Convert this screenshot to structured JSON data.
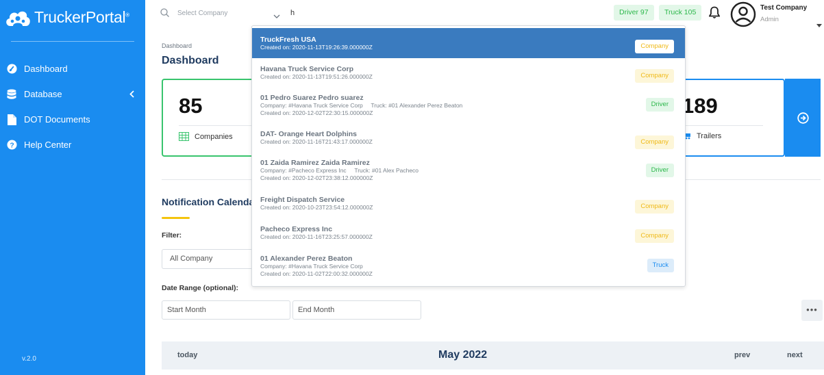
{
  "app": {
    "name": "TruckerPortal",
    "trademark": "®",
    "version": "v.2.0"
  },
  "sidebar": {
    "items": [
      {
        "label": "Dashboard",
        "icon": "dashboard-icon"
      },
      {
        "label": "Database",
        "icon": "database-icon"
      },
      {
        "label": "DOT Documents",
        "icon": "document-icon"
      },
      {
        "label": "Help Center",
        "icon": "help-icon"
      }
    ]
  },
  "topbar": {
    "company_select_placeholder": "Select Company",
    "search_value": "h",
    "driver_badge": "Driver 97",
    "truck_badge": "Truck 105",
    "user_name": "Test Company",
    "user_role": "Admin"
  },
  "main": {
    "breadcrumb": "Dashboard",
    "title": "Dashboard",
    "companies_count": "85",
    "companies_label": "Companies",
    "trailers_count": "189",
    "trailers_label": "Trailers",
    "section_title": "Notification Calendar",
    "filter_label": "Filter:",
    "filter_value": "All Company",
    "date_range_label": "Date Range (optional):",
    "start_month_placeholder": "Start Month",
    "end_month_placeholder": "End Month",
    "more_label": "•••"
  },
  "calendar": {
    "today": "today",
    "month": "May 2022",
    "prev": "prev",
    "next": "next"
  },
  "dropdown": {
    "items": [
      {
        "name": "TruckFresh USA",
        "detail": "",
        "created": "Created on: 2020-11-13T19:26:39.000000Z",
        "badge": "Company"
      },
      {
        "name": "Havana Truck Service Corp",
        "detail": "",
        "created": "Created on: 2020-11-13T19:51:26.000000Z",
        "badge": "Company"
      },
      {
        "name": "01 Pedro Suarez Pedro suarez",
        "detail": "Company: #Havana Truck Service Corp     Truck: #01 Alexander Perez Beaton",
        "created": "Created on: 2020-12-02T22:30:15.000000Z",
        "badge": "Driver"
      },
      {
        "name": "DAT- Orange Heart Dolphins",
        "detail": "",
        "created": "Created on: 2020-11-16T21:43:17.000000Z",
        "badge": "Company"
      },
      {
        "name": "01 Zaida Ramirez Zaida Ramirez",
        "detail": "Company: #Pacheco Express Inc     Truck: #01 Alex Pacheco",
        "created": "Created on: 2020-12-02T23:38:12.000000Z",
        "badge": "Driver"
      },
      {
        "name": "Freight Dispatch Service",
        "detail": "",
        "created": "Created on: 2020-10-23T23:54:12.000000Z",
        "badge": "Company"
      },
      {
        "name": "Pacheco Express Inc",
        "detail": "",
        "created": "Created on: 2020-11-16T23:25:57.000000Z",
        "badge": "Company"
      },
      {
        "name": "01 Alexander Perez Beaton",
        "detail": "Company: #Havana Truck Service Corp",
        "created": "Created on: 2020-11-02T22:00:32.000000Z",
        "badge": "Truck"
      }
    ]
  },
  "colors": {
    "sidebar": "#1a8cf0",
    "selected_row": "#3a7bbf",
    "company_badge": "#efb917",
    "driver_badge": "#2bb74a",
    "truck_badge": "#1a8cf0",
    "title_text": "#1e3a5f"
  }
}
